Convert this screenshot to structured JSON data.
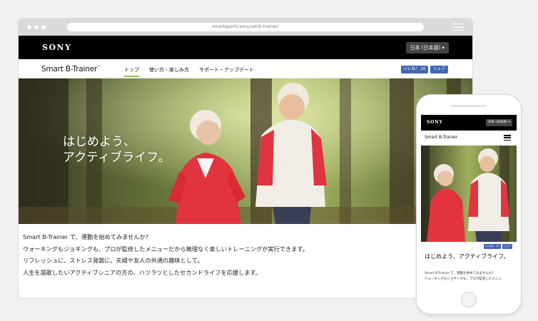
{
  "browser": {
    "url": "smartsports.sony.net/b-trainer/"
  },
  "header": {
    "brand_logo": "SONY",
    "language_button": "日本 (日本語) ▾"
  },
  "nav": {
    "site_brand": "Smart B-Trainer",
    "brand_tm": "™",
    "items": [
      {
        "label": "トップ",
        "active": true
      },
      {
        "label": "使い方・楽しみ方",
        "active": false
      },
      {
        "label": "サポート・アップデート",
        "active": false
      }
    ],
    "like_label": "いいね！ 20",
    "share_label": "シェア"
  },
  "hero": {
    "line1": "はじめよう、",
    "line2": "アクティブライフ。"
  },
  "content": {
    "lines": [
      "Smart B-Trainer で、運動を始めてみませんか?",
      "ウォーキングもジョギングも、プロが監修したメニューだから無理なく楽しいトレーニングが実行できます。",
      "リフレッシュに、ストレス発散に、夫婦や友人の共通の趣味として。",
      "人生を謳歌したいアクティブシニアの方の、ハツラツとしたセカンドライフを応援します。"
    ]
  },
  "phone": {
    "brand_logo": "SONY",
    "language_button": "日本 (日本語) ▾",
    "site_brand": "Smart B-Trainer",
    "like_label": "いいね！ 20",
    "share_label": "シェア",
    "heading": "はじめよう、アクティブライフ。",
    "text_line1": "Smart B-Trainer で、運動を始めてみませんか?",
    "text_line2": "ウォーキングもジョギングも、プロが監修したメニュ"
  },
  "colors": {
    "accent_green": "#8ac43f",
    "facebook_blue": "#4267b2",
    "header_black": "#000000"
  }
}
